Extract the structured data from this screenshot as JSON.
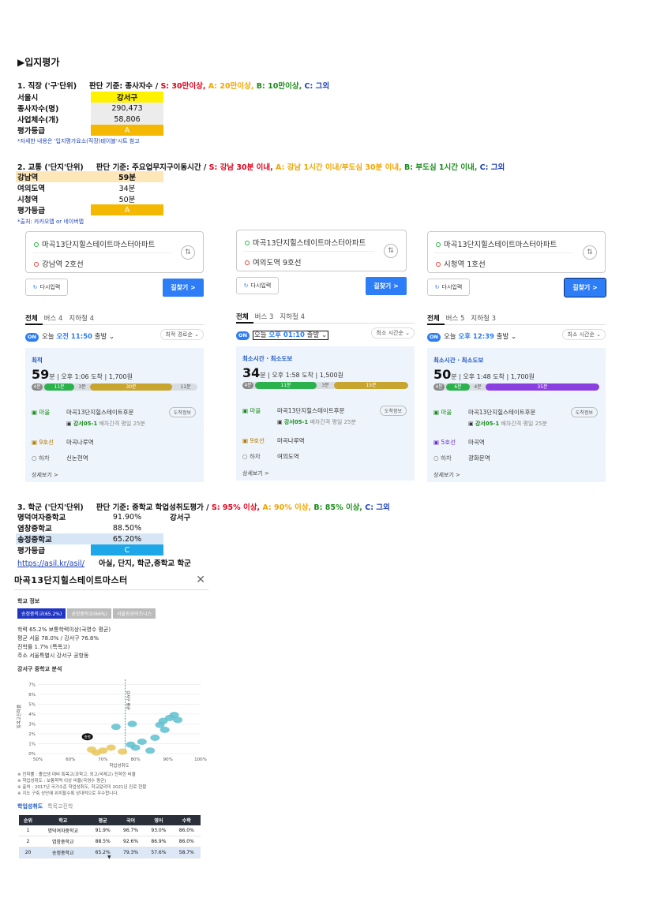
{
  "heading": "▶입지평가",
  "s1": {
    "title": "1. 직장 ('구'단위)",
    "criteria_prefix": "판단 기준: 종사자수 / ",
    "s": "S: 30만이상,",
    "a": " A: 20만이상,",
    "b": " B: 10만이상,",
    "c": " C: 그외",
    "rows": [
      {
        "label": "서울시",
        "value": "강서구"
      },
      {
        "label": "종사자수(명)",
        "value": "290,473"
      },
      {
        "label": "사업체수(개)",
        "value": "58,806"
      },
      {
        "label": "평가등급",
        "value": "A"
      }
    ],
    "note": "*자세한 내용은 '입지평가요소(직장)테이블'시트 참고"
  },
  "s2": {
    "title": "2. 교통 ('단지'단위)",
    "criteria_prefix": "판단 기준: 주요업무지구이동시간 / ",
    "s": "S: 강남 30분 이내,",
    "a": " A: 강남 1시간 이내/부도심 30분 이내,",
    "b": " B: 부도심 1시간 이내,",
    "c": " C: 그외",
    "rows": [
      {
        "label": "강남역",
        "value": "59분"
      },
      {
        "label": "여의도역",
        "value": "34분"
      },
      {
        "label": "시청역",
        "value": "50분"
      },
      {
        "label": "평가등급",
        "value": "A"
      }
    ],
    "note": "*출처: 카카오맵 or 네이버맵"
  },
  "cards": [
    {
      "origin": "마곡13단지힐스테이트마스터아파트",
      "dest": "강남역 2호선",
      "reset": "다시입력",
      "go": "길찾기 >",
      "tab_all": "전체",
      "tab_bus": "버스 4",
      "tab_sub": "지하철 4",
      "on": "ON",
      "on_pre": "오늘 ",
      "on_time": "오전 11:50",
      "on_post": " 출발 ⌄",
      "sort": "최적 경로순 ⌄",
      "type": "최적",
      "min": "59",
      "unit": "분",
      "detail": " | 오후 1:06 도착 | 1,700원",
      "seg_walk": "4분",
      "seg1": "11분",
      "seg_gap": "3분",
      "seg2": "30분",
      "seg_tail": "11분",
      "stop1": "마을",
      "stop1_name": "마곡13단지힐스테이트후문",
      "info": "도착정보",
      "bus": "강서05-1",
      "bus_note": " 배차간격 평일 25분",
      "stop2": "9호선",
      "stop2_name": "마곡나루역",
      "stop3": "하차",
      "stop3_name": "신논현역",
      "more": "상세보기 >"
    },
    {
      "origin": "마곡13단지힐스테이트마스터아파트",
      "dest": "여의도역 9호선",
      "reset": "다시입력",
      "go": "길찾기 >",
      "tab_all": "전체",
      "tab_bus": "버스 3",
      "tab_sub": "지하철 4",
      "on": "ON",
      "on_pre": "오늘 ",
      "on_time": "오후 01:10",
      "on_post": " 출발 ⌄",
      "sort": "최소 시간순 ⌄",
      "type": "최소시간 · 최소도보",
      "min": "34",
      "unit": "분",
      "detail": " | 오후 1:58 도착 | 1,500원",
      "seg_walk": "4분",
      "seg1": "11분",
      "seg_gap": "3분",
      "seg2": "15분",
      "seg_tail": "",
      "stop1": "마을",
      "stop1_name": "마곡13단지힐스테이트후문",
      "info": "도착정보",
      "bus": "강서05-1",
      "bus_note": " 배차간격 평일 25분",
      "stop2": "9호선",
      "stop2_name": "마곡나루역",
      "stop3": "하차",
      "stop3_name": "여의도역",
      "more": "상세보기 >"
    },
    {
      "origin": "마곡13단지힐스테이트마스터아파트",
      "dest": "시청역 1호선",
      "reset": "다시입력",
      "go": "길찾기 >",
      "tab_all": "전체",
      "tab_bus": "버스 5",
      "tab_sub": "지하철 3",
      "on": "ON",
      "on_pre": "오늘 ",
      "on_time": "오후 12:39",
      "on_post": " 출발 ⌄",
      "sort": "최소 시간순 ⌄",
      "type": "최소시간 · 최소도보",
      "min": "50",
      "unit": "분",
      "detail": " | 오후 1:48 도착 | 1,700원",
      "seg_walk": "4분",
      "seg1": "6분",
      "seg_gap": "4분",
      "seg2": "35분",
      "seg_tail": "",
      "stop1": "마을",
      "stop1_name": "마곡13단지힐스테이트후문",
      "info": "도착정보",
      "bus": "강서05-1",
      "bus_note": " 배차간격 평일 25분",
      "stop2": "5호선",
      "stop2_name": "마곡역",
      "stop3": "하차",
      "stop3_name": "광화문역",
      "more": "상세보기 >"
    }
  ],
  "s3": {
    "title": "3. 학군 ('단지'단위)",
    "criteria_prefix": "판단 기준: 중학교 학업성취도평가 / ",
    "s": "S: 95% 이상,",
    "a": " A: 90% 이상,",
    "b": " B: 85% 이상,",
    "c": " C: 그외",
    "rows": [
      {
        "label": "명덕여자중학교",
        "value": "91.90%",
        "extra": "강서구"
      },
      {
        "label": "염창중학교",
        "value": "88.50%",
        "extra": ""
      },
      {
        "label": "송정중학교",
        "value": "65.20%",
        "extra": ""
      },
      {
        "label": "평가등급",
        "value": "C",
        "extra": ""
      }
    ],
    "link": "https://asil.kr/asil/",
    "link_note": "아실, 단지, 학군,중학교 학군"
  },
  "widget": {
    "title": "마곡13단지힐스테이트마스터",
    "close": "✕",
    "section": "학교 정보",
    "chips": [
      "송정중학교(65.2%)",
      "공항중학교(66%)",
      "서울항공비즈니스"
    ],
    "lines": [
      "학력 65.2% 보통학력이상(국영수 평균)",
      "평균 서울 78.0% / 강서구 76.8%",
      "진학률 1.7% (특목고)",
      "주소 서울특별시 강서구 공항동"
    ],
    "chart_title": "강서구 중학교 분석",
    "footnotes": [
      "※ 진학률 : 졸업생 대비 특목고(과학고, 외고/국제고) 진학한 비율",
      "※ 학업성취도 : 보통학력 이상 비율(국영수 평균)",
      "※ 출처 : 2017년 국가수준 학업성취도, 학교알리미 2021년 진로 현황",
      "※ 지도 구축 상단에 위치할수록 상대적으로 우수합니다."
    ],
    "tab_a": "학업성취도",
    "tab_b": "특목고진학",
    "table_headers": [
      "순위",
      "학교",
      "평균",
      "국어",
      "영어",
      "수학"
    ],
    "table_rows": [
      [
        "1",
        "명덕여자중학교",
        "91.9%",
        "96.7%",
        "93.0%",
        "86.0%"
      ],
      [
        "2",
        "염창중학교",
        "88.5%",
        "92.6%",
        "86.9%",
        "86.0%"
      ],
      [
        "20",
        "송정중학교",
        "65.2%",
        "79.3%",
        "57.6%",
        "58.7%"
      ]
    ]
  },
  "chart_data": {
    "type": "scatter",
    "title": "강서구 중학교 분석",
    "xlabel": "학업성취도",
    "ylabel": "특목고진학률",
    "x_ticks": [
      "50%",
      "60%",
      "70%",
      "80%",
      "90%",
      "100%"
    ],
    "y_ticks": [
      "0%",
      "1%",
      "2%",
      "3%",
      "4%",
      "5%",
      "6%",
      "7%"
    ],
    "xlim": [
      50,
      100
    ],
    "ylim": [
      0,
      7.5
    ],
    "ref_line": {
      "label": "강서구 평균",
      "x": 76.8
    },
    "points": [
      {
        "x": 65.2,
        "y": 1.7,
        "label": "송정",
        "highlight": true
      },
      {
        "x": 91.9,
        "y": 3.9
      },
      {
        "x": 88.5,
        "y": 3.3
      },
      {
        "x": 90.5,
        "y": 3.6
      },
      {
        "x": 87.5,
        "y": 2.9
      },
      {
        "x": 93.0,
        "y": 3.4
      },
      {
        "x": 89.0,
        "y": 2.4
      },
      {
        "x": 86.0,
        "y": 1.6
      },
      {
        "x": 79.0,
        "y": 3.0
      },
      {
        "x": 74.0,
        "y": 2.7
      },
      {
        "x": 82.0,
        "y": 1.2
      },
      {
        "x": 84.5,
        "y": 0.3
      },
      {
        "x": 80.0,
        "y": 0.6
      },
      {
        "x": 72.5,
        "y": 0.6
      },
      {
        "x": 70.0,
        "y": 0.3
      },
      {
        "x": 68.0,
        "y": 0.1
      },
      {
        "x": 76.0,
        "y": 0.2
      },
      {
        "x": 78.5,
        "y": 0.9
      },
      {
        "x": 66.5,
        "y": 0.4
      }
    ]
  }
}
